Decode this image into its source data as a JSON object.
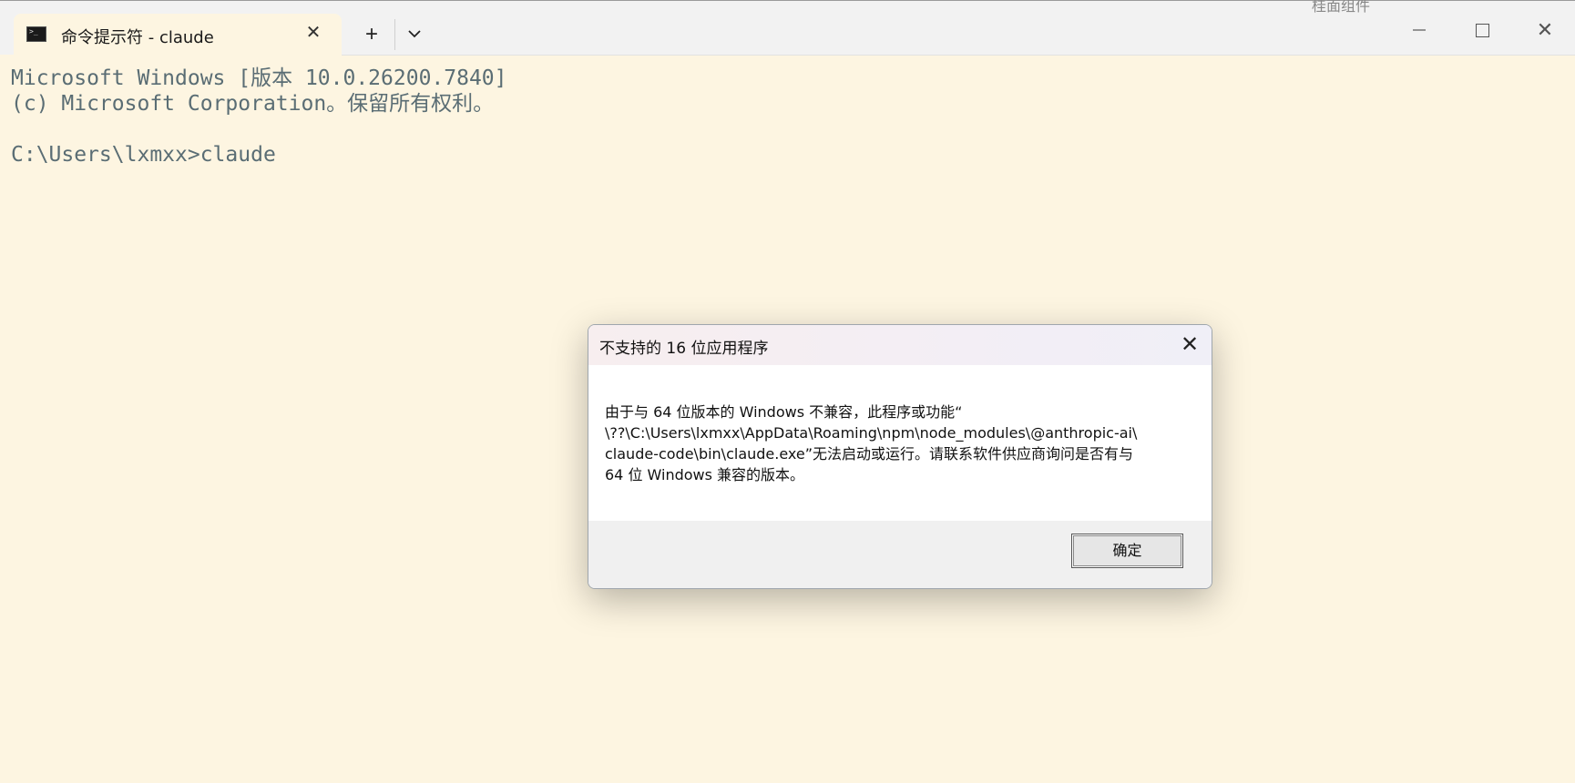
{
  "window": {
    "tab_title": "命令提示符 - claude",
    "tab_icon": "terminal-icon",
    "tab_close_glyph": "✕",
    "new_tab_glyph": "+",
    "dropdown_glyph": "⌄",
    "minimize_glyph": "—",
    "close_glyph": "✕",
    "background_faded_text": "桂面组件"
  },
  "terminal": {
    "lines": [
      "Microsoft Windows [版本 10.0.26200.7840]",
      "(c) Microsoft Corporation。保留所有权利。",
      "",
      "C:\\Users\\lxmxx>claude"
    ]
  },
  "dialog": {
    "title": "不支持的 16 位应用程序",
    "close_glyph": "✕",
    "message_lines": [
      "由于与 64 位版本的 Windows 不兼容，此程序或功能“",
      "\\??\\C:\\Users\\lxmxx\\AppData\\Roaming\\npm\\node_modules\\@anthropic-ai\\",
      "claude-code\\bin\\claude.exe”无法启动或运行。请联系软件供应商询问是否有与",
      "64 位 Windows 兼容的版本。"
    ],
    "ok_label": "确定"
  },
  "colors": {
    "terminal_bg": "#fdf5e1",
    "terminal_text": "#5a6d74",
    "titlebar_bg": "#f2f2f2"
  }
}
